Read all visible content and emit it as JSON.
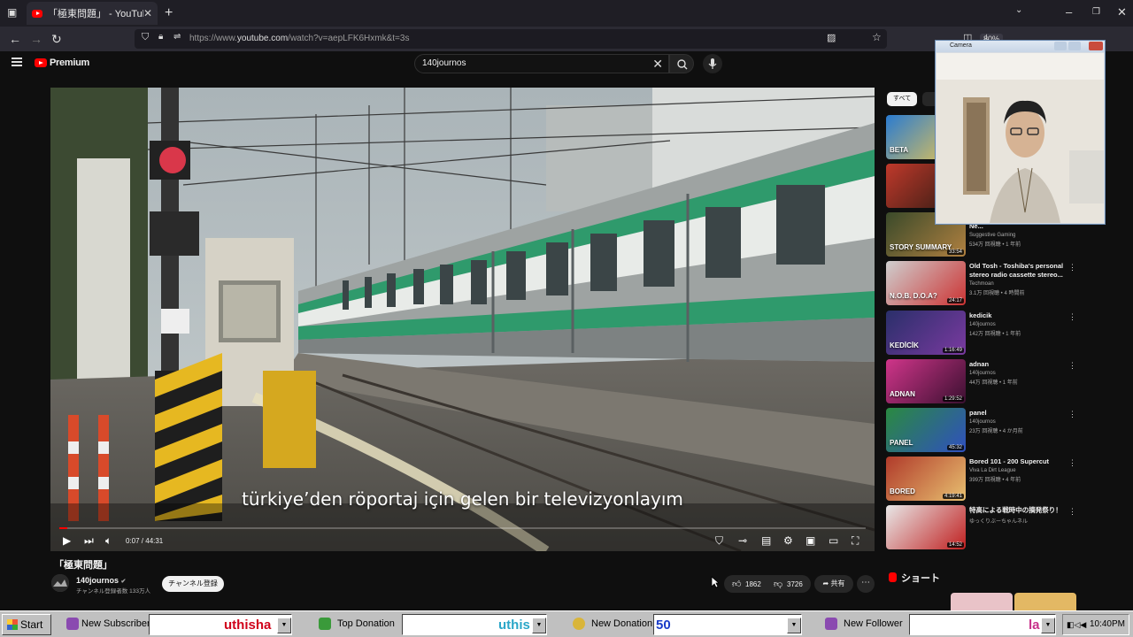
{
  "browser": {
    "tab_title": "「極東問題」 - YouTube",
    "tab_close": "✕",
    "new_tab": "+",
    "url_prefix": "https://www.",
    "url_domain": "youtube.com",
    "url_rest": "/watch?v=aepLFK6Hxmk&t=3s",
    "zoom": "80%"
  },
  "youtube": {
    "logo_text": "Premium",
    "search_value": "140journos",
    "video": {
      "subtitle": "türkiye’den röportaj için gelen bir televizyonlayım",
      "time": "0:07 / 44:31",
      "progress_fraction": 0.003
    },
    "title": "「極東問題」",
    "channel": {
      "name": "140journos",
      "subscribers": "チャンネル登録者数 133万人",
      "subscribe_label": "チャンネル登録"
    },
    "actions": {
      "likes": "1862",
      "dislikes": "3726",
      "share": "共有",
      "more": "⋯"
    },
    "sidebar": {
      "chip_all": "すべて",
      "shorts_label": "ショート",
      "recommendations": [
        {
          "title": "",
          "channel": "",
          "meta": "",
          "duration": "",
          "thumb_text": "BETA",
          "colors": [
            "#2a7bd0",
            "#f2c94c"
          ]
        },
        {
          "title": "",
          "channel": "",
          "meta": "",
          "duration": "",
          "thumb_text": "",
          "colors": [
            "#c0392b",
            "#2c1a12"
          ]
        },
        {
          "title": "Complete Story (What You Ne...",
          "channel": "Suggestive Gaming",
          "meta": "534万 回視聴 • 1 年前",
          "duration": "33:54",
          "thumb_text": "STORY SUMMARY",
          "colors": [
            "#3a4a2a",
            "#b08040"
          ]
        },
        {
          "title": "Old Tosh - Toshiba's personal stereo radio cassette stereo...",
          "channel": "Techmoan",
          "meta": "3.1万 回視聴 • 4 時間前",
          "duration": "24:17",
          "thumb_text": "N.O.B. D.O.A?",
          "colors": [
            "#cfcfcf",
            "#c33"
          ]
        },
        {
          "title": "kedicik",
          "channel": "140journos",
          "meta": "142万 回視聴 • 1 年前",
          "duration": "1:16:49",
          "thumb_text": "KEDİCİK",
          "colors": [
            "#2a2f6a",
            "#7a3aa0"
          ]
        },
        {
          "title": "adnan",
          "channel": "140journos",
          "meta": "44万 回視聴 • 1 年前",
          "duration": "1:29:52",
          "thumb_text": "ADNAN",
          "colors": [
            "#d0358a",
            "#3a1030"
          ]
        },
        {
          "title": "panel",
          "channel": "140journos",
          "meta": "23万 回視聴 • 4 か月前",
          "duration": "45:32",
          "thumb_text": "PANEL",
          "colors": [
            "#2a8a40",
            "#3050c0"
          ]
        },
        {
          "title": "Bored 101 - 200 Supercut",
          "channel": "Viva La Dirt League",
          "meta": "399万 回視聴 • 4 年前",
          "duration": "4:19:41",
          "thumb_text": "BORED",
          "colors": [
            "#b03a2a",
            "#e8c070"
          ]
        },
        {
          "title": "特高による戦時中の摘発祭り！",
          "channel": "ゆっくりぶーちゃんネル",
          "meta": "",
          "duration": "14:52",
          "thumb_text": "",
          "colors": [
            "#e8e8e8",
            "#c02020"
          ]
        }
      ]
    }
  },
  "camera": {
    "title": "Camera"
  },
  "taskbar": {
    "start": "Start",
    "new_subscriber_label": "New Subscriber",
    "new_subscriber_value": "uthisha",
    "top_donation_label": "Top Donation",
    "top_donation_value": "uthis",
    "new_donation_label": "New Donation",
    "new_donation_value": "50",
    "new_follower_label": "New Follower",
    "new_follower_value": "la",
    "clock": "10:40PM",
    "accent_value_color": "#d0021b",
    "accent_value_color_2": "#1a3cc8"
  }
}
